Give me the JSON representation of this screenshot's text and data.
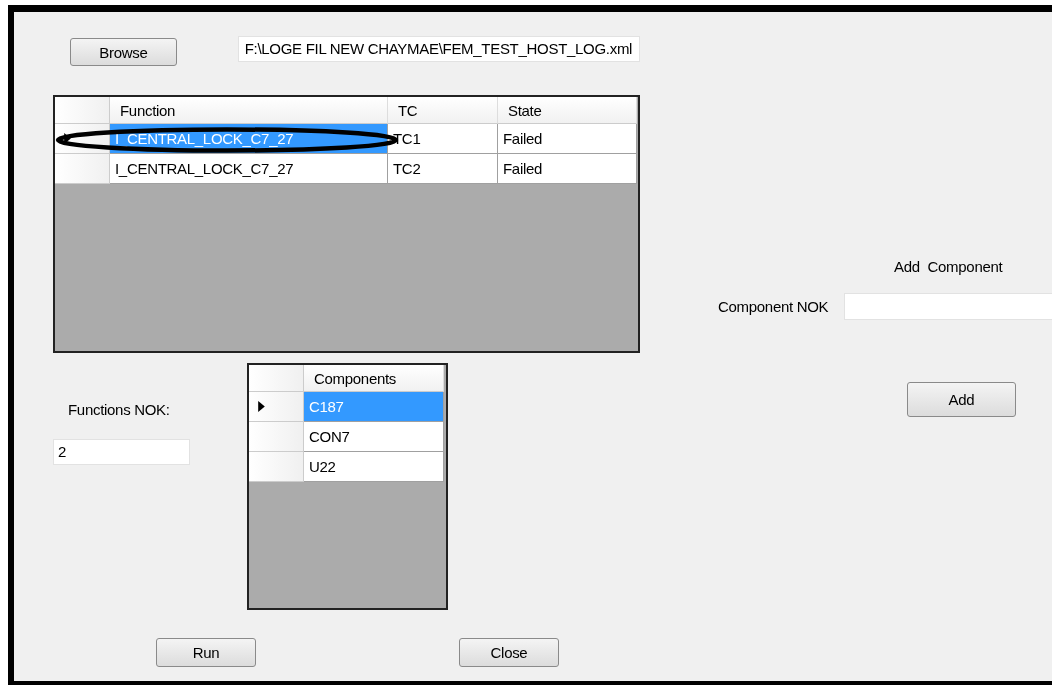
{
  "browse_button": "Browse",
  "file_path": "F:\\LOGE FIL NEW CHAYMAE\\FEM_TEST_HOST_LOG.xml",
  "functions_table": {
    "columns": [
      "Function",
      "TC",
      "State"
    ],
    "rows": [
      {
        "cells": [
          "I_CENTRAL_LOCK_C7_27",
          "TC1",
          "Failed"
        ],
        "selected": true
      },
      {
        "cells": [
          "I_CENTRAL_LOCK_C7_27",
          "TC2",
          "Failed"
        ],
        "selected": false
      }
    ]
  },
  "annotation": {
    "kind": "ellipse"
  },
  "functions_nok": {
    "label": "Functions NOK:",
    "value": "2"
  },
  "components_table": {
    "columns": [
      "Components"
    ],
    "rows": [
      {
        "cells": [
          "C187"
        ],
        "selected": true
      },
      {
        "cells": [
          "CON7"
        ],
        "selected": false
      },
      {
        "cells": [
          "U22"
        ],
        "selected": false
      }
    ]
  },
  "add_component": {
    "title": "Add  Component",
    "label": "Component NOK",
    "button": "Add"
  },
  "buttons": [
    "Run",
    "Close"
  ]
}
